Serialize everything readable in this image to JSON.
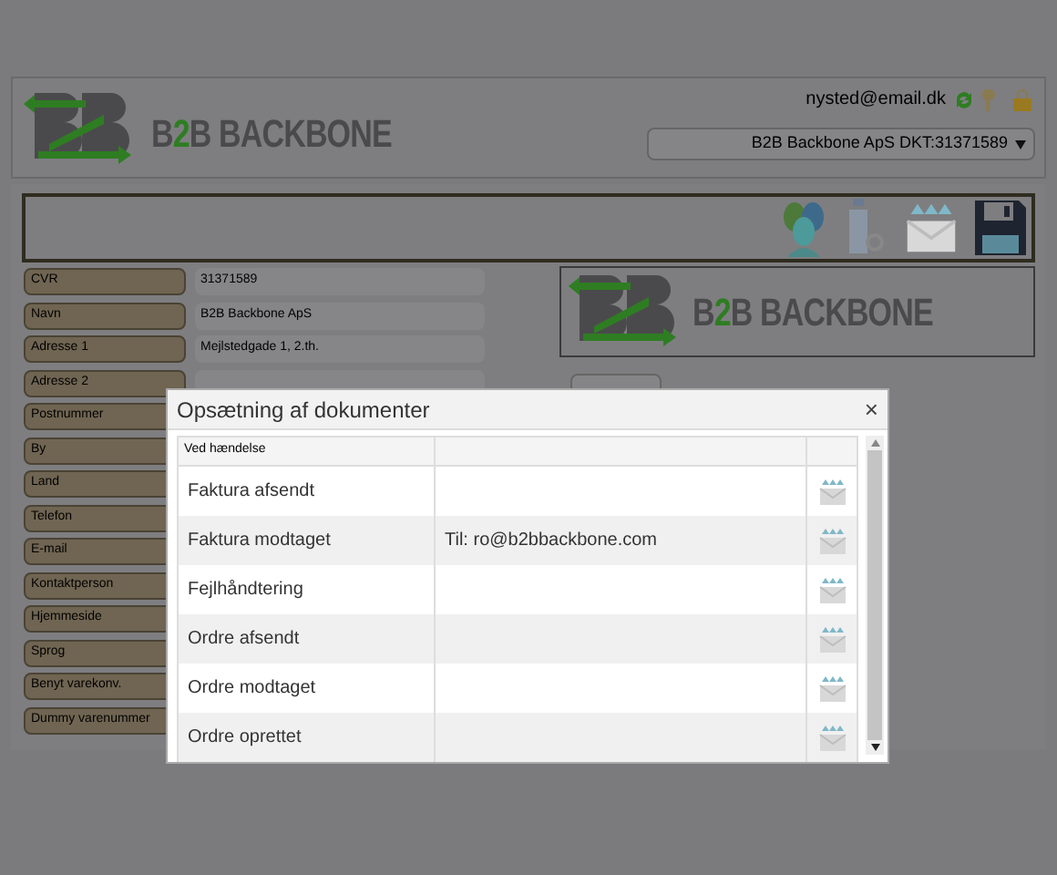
{
  "header": {
    "brand": {
      "before": "B",
      "accent": "2",
      "after": "B BACKBONE"
    },
    "user_email": "nysted@email.dk",
    "company_select": {
      "value": "B2B Backbone ApS DKT:31371589"
    }
  },
  "form": {
    "fields": [
      {
        "label": "CVR",
        "value": "31371589"
      },
      {
        "label": "Navn",
        "value": "B2B Backbone ApS"
      },
      {
        "label": "Adresse 1",
        "value": "Mejlstedgade 1, 2.th."
      },
      {
        "label": "Adresse 2",
        "input": true
      },
      {
        "label": "Postnummer"
      },
      {
        "label": "By"
      },
      {
        "label": "Land"
      },
      {
        "label": "Telefon"
      },
      {
        "label": "E-mail"
      },
      {
        "label": "Kontaktperson"
      },
      {
        "label": "Hjemmeside"
      },
      {
        "label": "Sprog"
      },
      {
        "label": "Benyt varekonv."
      },
      {
        "label": "Dummy varenummer"
      }
    ]
  },
  "logo_panel": {
    "brand": {
      "before": "B",
      "accent": "2",
      "after": "B BACKBONE"
    }
  },
  "dialog": {
    "title": "Opsætning af dokumenter",
    "close": "×",
    "columns": [
      "Ved hændelse"
    ],
    "rows": [
      {
        "event": "Faktura afsendt"
      },
      {
        "event": "Faktura modtaget",
        "recipient": "Til: ro@b2bbackbone.com"
      },
      {
        "event": "Fejlhåndtering"
      },
      {
        "event": "Ordre afsendt"
      },
      {
        "event": "Ordre modtaget"
      },
      {
        "event": "Ordre oprettet"
      }
    ]
  }
}
